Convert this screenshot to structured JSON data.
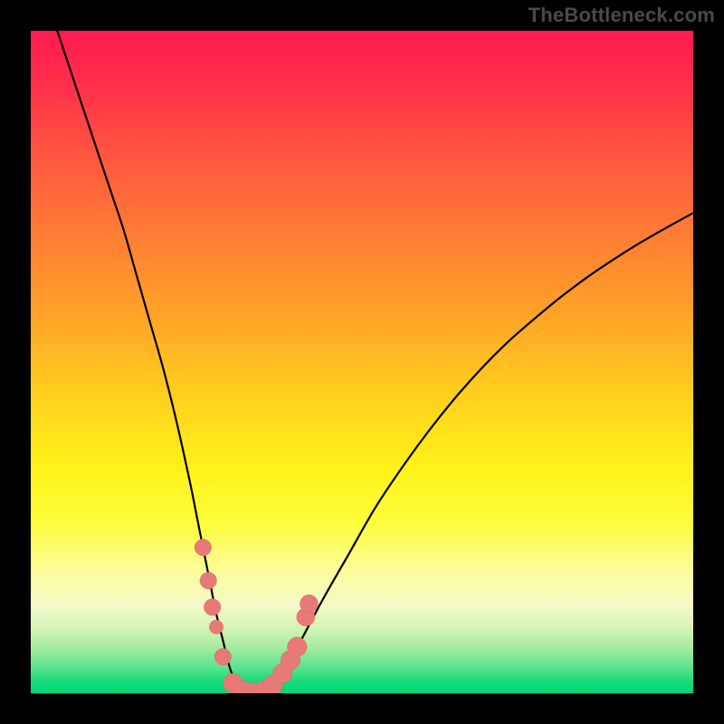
{
  "watermark": "TheBottleneck.com",
  "colors": {
    "frame": "#000000",
    "watermark_text": "#4a4a4a",
    "curve_stroke": "#000000",
    "marker_fill": "#e77a77",
    "marker_stroke": "#d86a67",
    "gradient_top": "#ff1a52",
    "gradient_bottom": "#00d875"
  },
  "chart_data": {
    "type": "line",
    "title": "",
    "xlabel": "",
    "ylabel": "",
    "x_range": [
      0,
      100
    ],
    "y_range": [
      0,
      100
    ],
    "series": [
      {
        "name": "bottleneck-curve",
        "x": [
          4,
          6,
          8,
          10,
          12,
          14,
          16,
          18,
          20,
          22,
          24,
          25,
          26,
          27,
          28,
          29,
          30,
          31,
          32,
          33,
          34,
          35,
          36,
          38,
          40,
          44,
          48,
          52,
          56,
          60,
          64,
          68,
          72,
          76,
          80,
          84,
          88,
          92,
          96,
          100
        ],
        "y": [
          100,
          94,
          88,
          82,
          76,
          70,
          63,
          56,
          49,
          41,
          32,
          27,
          22,
          17,
          12,
          8,
          4,
          1.5,
          0.3,
          0,
          0,
          0.2,
          1,
          3,
          6.5,
          14,
          21,
          28,
          34,
          39.5,
          44.5,
          49,
          53,
          56.5,
          59.8,
          62.8,
          65.5,
          68,
          70.3,
          72.5
        ]
      }
    ],
    "markers": {
      "name": "highlight-dots",
      "points": [
        {
          "x": 26.0,
          "y": 22.0,
          "r": 1.2
        },
        {
          "x": 26.8,
          "y": 17.0,
          "r": 1.2
        },
        {
          "x": 27.4,
          "y": 13.0,
          "r": 1.2
        },
        {
          "x": 28.0,
          "y": 10.0,
          "r": 1.0
        },
        {
          "x": 29.0,
          "y": 5.5,
          "r": 1.2
        },
        {
          "x": 30.5,
          "y": 1.5,
          "r": 1.4
        },
        {
          "x": 32.0,
          "y": 0.4,
          "r": 1.4
        },
        {
          "x": 33.5,
          "y": 0.1,
          "r": 1.4
        },
        {
          "x": 35.0,
          "y": 0.3,
          "r": 1.4
        },
        {
          "x": 36.5,
          "y": 1.2,
          "r": 1.4
        },
        {
          "x": 38.0,
          "y": 3.0,
          "r": 1.4
        },
        {
          "x": 39.2,
          "y": 5.0,
          "r": 1.4
        },
        {
          "x": 40.2,
          "y": 7.0,
          "r": 1.4
        },
        {
          "x": 41.5,
          "y": 11.5,
          "r": 1.3
        },
        {
          "x": 42.0,
          "y": 13.5,
          "r": 1.3
        }
      ]
    }
  }
}
